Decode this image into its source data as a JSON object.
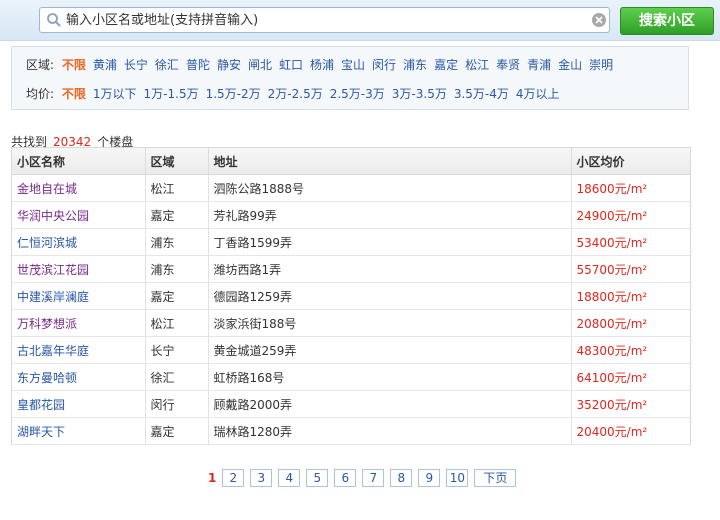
{
  "search": {
    "placeholder": "输入小区名或地址(支持拼音输入)",
    "button_label": "搜索小区"
  },
  "filters": {
    "district_label": "区域:",
    "districts": [
      "不限",
      "黄浦",
      "长宁",
      "徐汇",
      "普陀",
      "静安",
      "闸北",
      "虹口",
      "杨浦",
      "宝山",
      "闵行",
      "浦东",
      "嘉定",
      "松江",
      "奉贤",
      "青浦",
      "金山",
      "崇明"
    ],
    "price_label": "均价:",
    "prices": [
      "不限",
      "1万以下",
      "1万-1.5万",
      "1.5万-2万",
      "2万-2.5万",
      "2.5万-3万",
      "3万-3.5万",
      "3.5万-4万",
      "4万以上"
    ],
    "active_district": "不限",
    "active_price": "不限"
  },
  "result": {
    "prefix": "共找到",
    "count": "20342",
    "suffix": "个楼盘"
  },
  "table": {
    "headers": [
      "小区名称",
      "区域",
      "地址",
      "小区均价"
    ],
    "unit": "元/㎡",
    "rows": [
      {
        "name": "金地自在城",
        "district": "松江",
        "address": "泗陈公路1888号",
        "price": "18600元/m²",
        "visited": true
      },
      {
        "name": "华润中央公园",
        "district": "嘉定",
        "address": "芳礼路99弄",
        "price": "24900元/m²",
        "visited": true
      },
      {
        "name": "仁恒河滨城",
        "district": "浦东",
        "address": "丁香路1599弄",
        "price": "53400元/m²",
        "visited": false
      },
      {
        "name": "世茂滨江花园",
        "district": "浦东",
        "address": "潍坊西路1弄",
        "price": "55700元/m²",
        "visited": true
      },
      {
        "name": "中建溪岸澜庭",
        "district": "嘉定",
        "address": "德园路1259弄",
        "price": "18800元/m²",
        "visited": false
      },
      {
        "name": "万科梦想派",
        "district": "松江",
        "address": "淡家浜街188号",
        "price": "20800元/m²",
        "visited": true
      },
      {
        "name": "古北嘉年华庭",
        "district": "长宁",
        "address": "黄金城道259弄",
        "price": "48300元/m²",
        "visited": false
      },
      {
        "name": "东方曼哈顿",
        "district": "徐汇",
        "address": "虹桥路168号",
        "price": "64100元/m²",
        "visited": false
      },
      {
        "name": "皇都花园",
        "district": "闵行",
        "address": "顾戴路2000弄",
        "price": "35200元/m²",
        "visited": false
      },
      {
        "name": "湖畔天下",
        "district": "嘉定",
        "address": "瑞林路1280弄",
        "price": "20400元/m²",
        "visited": false
      }
    ]
  },
  "pagination": {
    "current": "1",
    "pages": [
      "2",
      "3",
      "4",
      "5",
      "6",
      "7",
      "8",
      "9",
      "10"
    ],
    "next_label": "下页"
  },
  "colors": {
    "accent_green": "#2f9e27",
    "price_red": "#e0261d",
    "link_blue": "#2a57a8",
    "visited_purple": "#7a2a8c",
    "active_orange": "#f26522"
  }
}
